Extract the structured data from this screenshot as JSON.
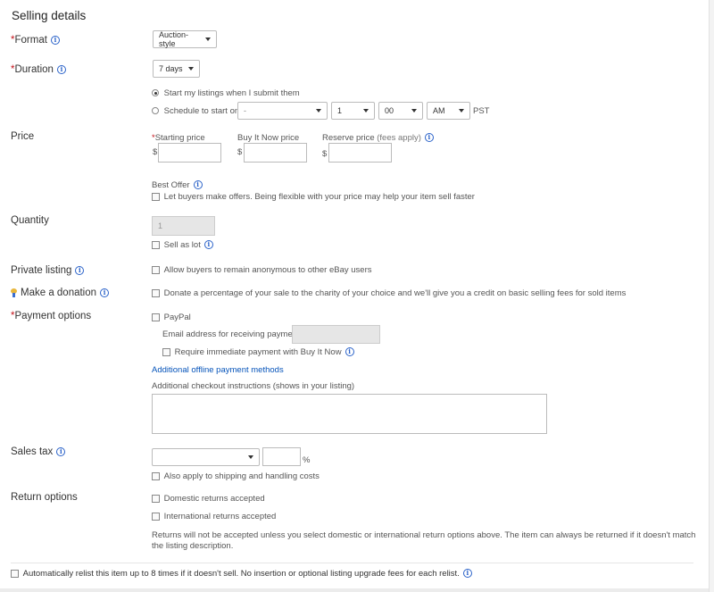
{
  "header": {
    "title": "Selling details"
  },
  "format": {
    "label": "Format",
    "value": "Auction-style"
  },
  "duration": {
    "label": "Duration",
    "value": "7 days",
    "radio_now": "Start my listings when I submit them",
    "radio_schedule": "Schedule to start on",
    "date": "-",
    "hour": "1",
    "minute": "00",
    "ampm": "AM",
    "tz": "PST"
  },
  "price": {
    "label": "Price",
    "starting_label": "Starting price",
    "bin_label": "Buy It Now price",
    "reserve_label": "Reserve price",
    "reserve_fees": "(fees apply)",
    "currency": "$",
    "best_offer_label": "Best Offer",
    "best_offer_checkbox": "Let buyers make offers. Being flexible with your price may help your item sell faster"
  },
  "quantity": {
    "label": "Quantity",
    "placeholder": "1",
    "sell_as_lot": "Sell as lot"
  },
  "private_listing": {
    "label": "Private listing",
    "checkbox": "Allow buyers to remain anonymous to other eBay users"
  },
  "donation": {
    "label": "Make a donation",
    "checkbox": "Donate a percentage of your sale to the charity of your choice and we'll give you a credit on basic selling fees for sold items"
  },
  "payment": {
    "label": "Payment options",
    "paypal": "PayPal",
    "email_label": "Email address for receiving payment:",
    "immediate": "Require immediate payment with Buy It Now",
    "offline_link": "Additional offline payment methods",
    "checkout_label": "Additional checkout instructions (shows in your listing)"
  },
  "sales_tax": {
    "label": "Sales tax",
    "percent": "%",
    "also_apply": "Also apply to shipping and handling costs"
  },
  "returns": {
    "label": "Return options",
    "domestic": "Domestic returns accepted",
    "international": "International returns accepted",
    "note": "Returns will not be accepted unless you select domestic or international return options above. The item can always be returned if it doesn't match the listing description."
  },
  "relist": {
    "label": "Automatically relist this item up to 8 times if it doesn't sell. No insertion or optional listing upgrade fees for each relist."
  },
  "colors": {
    "required": "#c5141c",
    "link": "#0654ba",
    "info": "#2a62c9"
  }
}
